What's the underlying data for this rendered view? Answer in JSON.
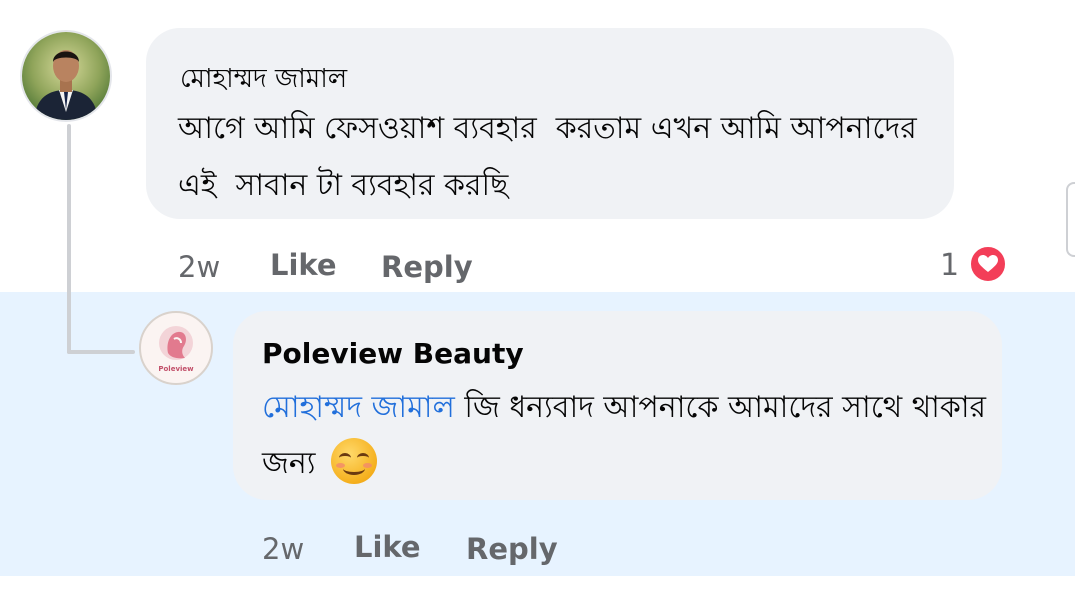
{
  "comment": {
    "author": "মোহাম্মদ জামাল",
    "text": "আগে আমি ফেসওয়াশ ব্যবহার  করতাম এখন আমি আপনাদের এই  সাবান টা ব্যবহার করছি",
    "time": "2w",
    "like_label": "Like",
    "reply_label": "Reply",
    "reaction_count": "1",
    "reaction_icon": "heart-icon",
    "reaction_color": "#f33e58"
  },
  "reply": {
    "author": "Poleview Beauty",
    "avatar_text": "Poleview",
    "mention": "মোহাম্মদ জামাল",
    "text": " জি ধন্যবাদ আপনাকে আমাদের সাথে থাকার জন্য",
    "emoji": "smiling-face-emoji",
    "time": "2w",
    "like_label": "Like",
    "reply_label": "Reply"
  },
  "colors": {
    "bubble": "#f0f2f5",
    "reply_highlight": "#e7f3ff",
    "mention": "#216fdb",
    "meta_text": "#65676b"
  }
}
